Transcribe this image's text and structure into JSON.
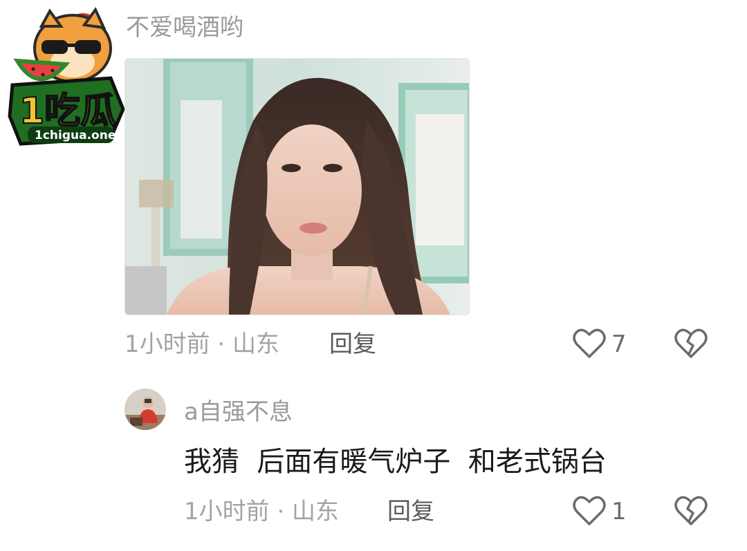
{
  "watermark": {
    "logo_text": "1吃瓜",
    "logo_domain": "1chigua.one"
  },
  "comment": {
    "username": "不爱喝酒哟",
    "time_location": "1小时前 · 山东",
    "reply_label": "回复",
    "like_count": "7"
  },
  "reply_comment": {
    "username": "a自强不息",
    "text": "我猜  后面有暖气炉子  和老式锅台",
    "time_location": "1小时前 · 山东",
    "reply_label": "回复",
    "like_count": "1"
  },
  "colors": {
    "meta_gray": "#a3a3a3",
    "icon_gray": "#6b6b6b",
    "logo_green": "#2f8a2b",
    "logo_yellow": "#f4c430"
  },
  "icons": [
    "heart-outline-icon",
    "broken-heart-icon"
  ]
}
